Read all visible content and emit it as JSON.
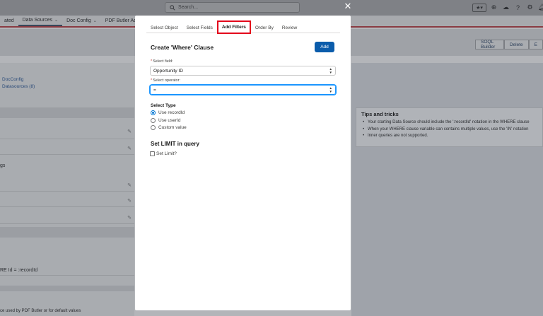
{
  "topbar": {
    "search_placeholder": "Search...",
    "icons": [
      "star-icon",
      "add-icon",
      "cloud-icon",
      "help-icon",
      "gear-icon",
      "bell-icon",
      "avatar"
    ]
  },
  "nav": {
    "items": [
      {
        "label": "ated",
        "has_menu": false,
        "active": false
      },
      {
        "label": "Data Sources",
        "has_menu": true,
        "active": true
      },
      {
        "label": "Doc Config",
        "has_menu": true,
        "active": false
      },
      {
        "label": "PDF Butler Admin",
        "has_menu": false,
        "active": false
      }
    ]
  },
  "header": {
    "buttons": [
      "SOQL Builder",
      "Delete",
      "E"
    ]
  },
  "left_panel": {
    "links": [
      "DocConfig",
      "Datasources (8)"
    ],
    "section_label": "gs",
    "where_fragment": "RE Id = :recordId",
    "footer_text": "ce used by PDF Butler or for default values"
  },
  "tips": {
    "title": "Tips and tricks",
    "items": [
      "Your starting Data Source should include the ':recordId' notation in the WHERE clause",
      "When your WHERE clause variable can contains multiple values, use the 'IN' notation",
      "Inner queries are not supported."
    ]
  },
  "modal": {
    "tabs": [
      {
        "label": "Select Object",
        "active": false
      },
      {
        "label": "Select Fields",
        "active": false
      },
      {
        "label": "Add Filters",
        "active": true
      },
      {
        "label": "Order By",
        "active": false
      },
      {
        "label": "Review",
        "active": false
      }
    ],
    "title": "Create 'Where' Clause",
    "add_button": "Add",
    "field_label": "Select field:",
    "field_value": "Opportunity ID",
    "operator_label": "Select operator:",
    "operator_value": "=",
    "type_title": "Select Type",
    "type_options": [
      {
        "label": "Use recordId",
        "selected": true
      },
      {
        "label": "Use userId",
        "selected": false
      },
      {
        "label": "Custom value",
        "selected": false
      }
    ],
    "limit_title": "Set LIMIT in query",
    "limit_checkbox": "Set Limit?",
    "limit_checked": false
  },
  "colors": {
    "brand_button": "#0b5cab",
    "tab_highlight": "#e3001b",
    "focus_ring": "#1b96ff",
    "overlay": "#7f8289"
  }
}
